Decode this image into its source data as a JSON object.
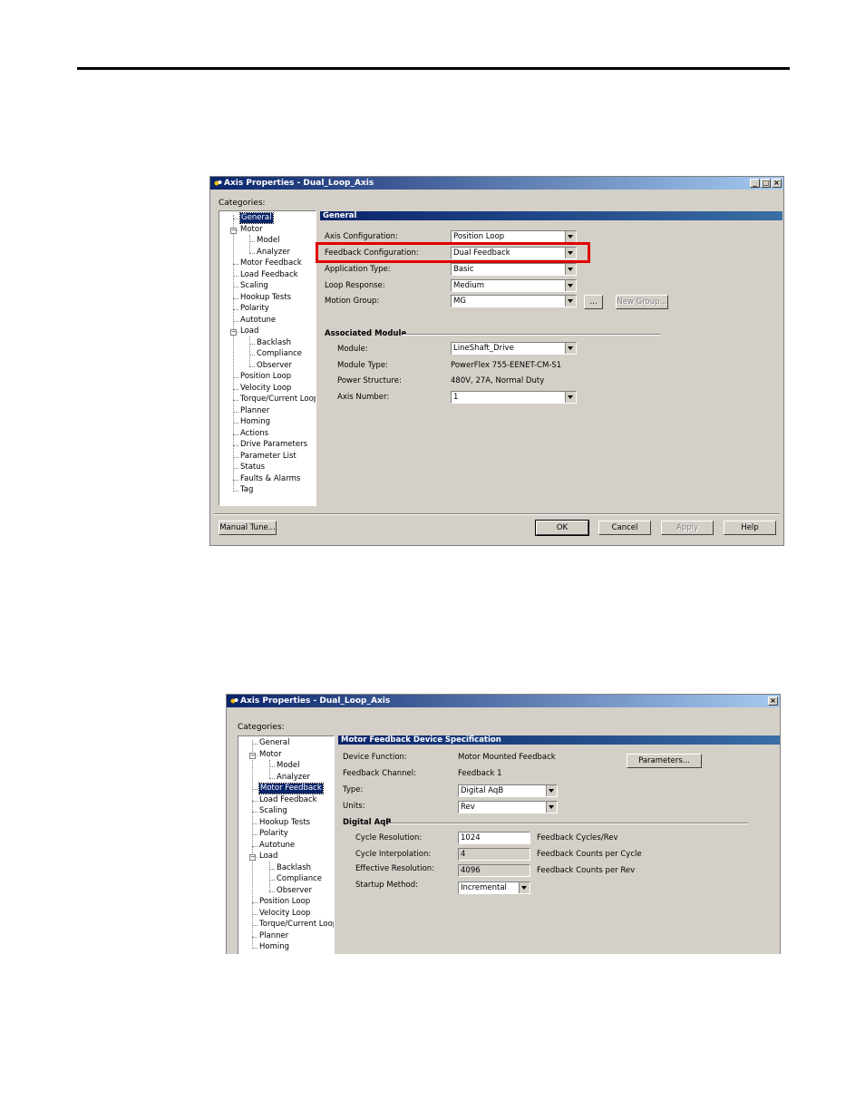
{
  "window1": {
    "title": "Axis Properties - Dual_Loop_Axis",
    "categories_label": "Categories:",
    "tree": [
      {
        "label": "General",
        "level": 1,
        "selected": true
      },
      {
        "label": "Motor",
        "level": 1,
        "expander": "-"
      },
      {
        "label": "Model",
        "level": 2
      },
      {
        "label": "Analyzer",
        "level": 2
      },
      {
        "label": "Motor Feedback",
        "level": 1
      },
      {
        "label": "Load Feedback",
        "level": 1
      },
      {
        "label": "Scaling",
        "level": 1
      },
      {
        "label": "Hookup Tests",
        "level": 1
      },
      {
        "label": "Polarity",
        "level": 1
      },
      {
        "label": "Autotune",
        "level": 1
      },
      {
        "label": "Load",
        "level": 1,
        "expander": "-"
      },
      {
        "label": "Backlash",
        "level": 2
      },
      {
        "label": "Compliance",
        "level": 2
      },
      {
        "label": "Observer",
        "level": 2
      },
      {
        "label": "Position Loop",
        "level": 1
      },
      {
        "label": "Velocity Loop",
        "level": 1
      },
      {
        "label": "Torque/Current Loop",
        "level": 1
      },
      {
        "label": "Planner",
        "level": 1
      },
      {
        "label": "Homing",
        "level": 1
      },
      {
        "label": "Actions",
        "level": 1
      },
      {
        "label": "Drive Parameters",
        "level": 1
      },
      {
        "label": "Parameter List",
        "level": 1
      },
      {
        "label": "Status",
        "level": 1
      },
      {
        "label": "Faults & Alarms",
        "level": 1
      },
      {
        "label": "Tag",
        "level": 1
      }
    ],
    "section_title": "General",
    "fields": {
      "axis_configuration": {
        "label": "Axis Configuration:",
        "value": "Position Loop"
      },
      "feedback_configuration": {
        "label": "Feedback Configuration:",
        "value": "Dual Feedback"
      },
      "application_type": {
        "label": "Application Type:",
        "value": "Basic"
      },
      "loop_response": {
        "label": "Loop Response:",
        "value": "Medium"
      },
      "motion_group": {
        "label": "Motion Group:",
        "value": "MG"
      }
    },
    "browse_label": "...",
    "new_group_label": "New Group...",
    "associated_module": {
      "title": "Associated Module",
      "module": {
        "label": "Module:",
        "value": "LineShaft_Drive"
      },
      "module_type": {
        "label": "Module Type:",
        "value": "PowerFlex 755-EENET-CM-S1"
      },
      "power_structure": {
        "label": "Power Structure:",
        "value": "480V, 27A, Normal Duty"
      },
      "axis_number": {
        "label": "Axis Number:",
        "value": "1"
      }
    },
    "buttons": {
      "manual_tune": "Manual Tune...",
      "ok": "OK",
      "cancel": "Cancel",
      "apply": "Apply",
      "help": "Help"
    },
    "highlight_color": "#e00000"
  },
  "window2": {
    "title": "Axis Properties - Dual_Loop_Axis",
    "categories_label": "Categories:",
    "tree": [
      {
        "label": "General",
        "level": 1
      },
      {
        "label": "Motor",
        "level": 1,
        "expander": "-"
      },
      {
        "label": "Model",
        "level": 2
      },
      {
        "label": "Analyzer",
        "level": 2
      },
      {
        "label": "Motor Feedback",
        "level": 1,
        "selected": true
      },
      {
        "label": "Load Feedback",
        "level": 1
      },
      {
        "label": "Scaling",
        "level": 1
      },
      {
        "label": "Hookup Tests",
        "level": 1
      },
      {
        "label": "Polarity",
        "level": 1
      },
      {
        "label": "Autotune",
        "level": 1
      },
      {
        "label": "Load",
        "level": 1,
        "expander": "-"
      },
      {
        "label": "Backlash",
        "level": 2
      },
      {
        "label": "Compliance",
        "level": 2
      },
      {
        "label": "Observer",
        "level": 2
      },
      {
        "label": "Position Loop",
        "level": 1
      },
      {
        "label": "Velocity Loop",
        "level": 1
      },
      {
        "label": "Torque/Current Loop",
        "level": 1
      },
      {
        "label": "Planner",
        "level": 1
      },
      {
        "label": "Homing",
        "level": 1
      }
    ],
    "section_title": "Motor Feedback Device Specification",
    "device_function": {
      "label": "Device Function:",
      "value": "Motor Mounted Feedback"
    },
    "feedback_channel": {
      "label": "Feedback Channel:",
      "value": "Feedback 1"
    },
    "type": {
      "label": "Type:",
      "value": "Digital AqB"
    },
    "units": {
      "label": "Units:",
      "value": "Rev"
    },
    "parameters_label": "Parameters...",
    "digital_aqb": {
      "title": "Digital AqB",
      "cycle_resolution": {
        "label": "Cycle Resolution:",
        "value": "1024",
        "unit": "Feedback Cycles/Rev"
      },
      "cycle_interpolation": {
        "label": "Cycle Interpolation:",
        "value": "4",
        "unit": "Feedback Counts per Cycle"
      },
      "effective_resolution": {
        "label": "Effective Resolution:",
        "value": "4096",
        "unit": "Feedback Counts per Rev"
      },
      "startup_method": {
        "label": "Startup Method:",
        "value": "Incremental"
      }
    }
  }
}
